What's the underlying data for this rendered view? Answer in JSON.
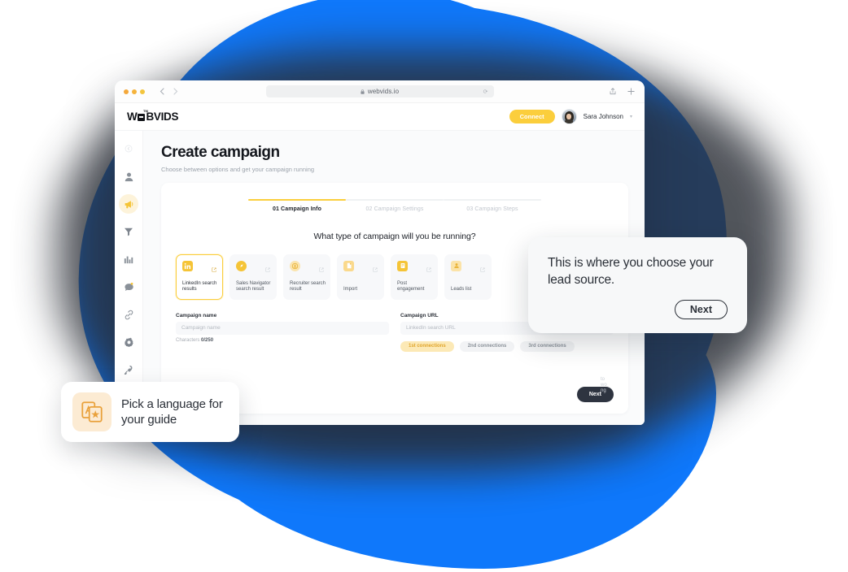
{
  "browser": {
    "url": "webvids.io",
    "lock_icon": "lock-icon",
    "reload_icon": "reload-icon",
    "back_icon": "chevron-left-icon",
    "forward_icon": "chevron-right-icon",
    "share_icon": "share-icon",
    "newtab_icon": "plus-icon",
    "traffic_lights": [
      "close-dot",
      "minimize-dot",
      "maximize-dot"
    ]
  },
  "app": {
    "logo": "WEBVIDS",
    "logo_mark": "E",
    "logo_trademark": "TM",
    "connect_label": "Connect",
    "user_name": "Sara Johnson",
    "user_chevron": "chevron-down-icon"
  },
  "sidebar": {
    "items": [
      {
        "icon": "collapse-icon",
        "name": "sidebar-item-collapse",
        "active": false
      },
      {
        "icon": "user-icon",
        "name": "sidebar-item-contacts",
        "active": false
      },
      {
        "icon": "megaphone-icon",
        "name": "sidebar-item-campaigns",
        "active": true
      },
      {
        "icon": "filter-icon",
        "name": "sidebar-item-filters",
        "active": false
      },
      {
        "icon": "bar-chart-icon",
        "name": "sidebar-item-analytics",
        "active": false
      },
      {
        "icon": "chat-icon",
        "name": "sidebar-item-inbox",
        "active": false
      },
      {
        "icon": "link-icon",
        "name": "sidebar-item-integrations",
        "active": false
      },
      {
        "icon": "gear-icon",
        "name": "sidebar-item-settings",
        "active": false
      },
      {
        "icon": "rocket-icon",
        "name": "sidebar-item-upgrade",
        "active": false
      }
    ]
  },
  "page": {
    "title": "Create campaign",
    "subtitle": "Choose between options and get your campaign running"
  },
  "wizard": {
    "steps": [
      {
        "num": "01",
        "label": "01 Campaign Info",
        "active": true
      },
      {
        "num": "02",
        "label": "02 Campaign Settings",
        "active": false
      },
      {
        "num": "03",
        "label": "03 Campaign Steps",
        "active": false
      }
    ],
    "question": "What type of campaign will you be running?",
    "campaign_types": [
      {
        "label": "LinkedIn search results",
        "icon": "linkedin-icon",
        "selected": true
      },
      {
        "label": "Sales Navigator search result",
        "icon": "compass-icon",
        "selected": false
      },
      {
        "label": "Recruiter search result",
        "icon": "recruiter-badge-icon",
        "selected": false
      },
      {
        "label": "Import",
        "icon": "file-import-icon",
        "selected": false
      },
      {
        "label": "Post engagement",
        "icon": "post-icon",
        "selected": false
      },
      {
        "label": "Leads list",
        "icon": "leads-list-icon",
        "selected": false
      }
    ],
    "external_icon": "external-link-icon",
    "campaign_name": {
      "label": "Campaign name",
      "placeholder": "Campaign name",
      "value": "",
      "char_prefix": "Characters",
      "char_count": "0/250"
    },
    "campaign_url": {
      "label": "Campaign URL",
      "placeholder": "LinkedIn search URL",
      "value": ""
    },
    "connections": [
      {
        "label": "1st connections",
        "selected": true
      },
      {
        "label": "2nd connections",
        "selected": false
      },
      {
        "label": "3rd connections",
        "selected": false
      }
    ],
    "next_label": "Next",
    "ghost_text": "to wo ng"
  },
  "callouts": {
    "lead_source": {
      "text": "This is where you choose your lead source.",
      "button": "Next"
    },
    "language": {
      "text": "Pick a language for your guide",
      "icon": "translate-icon"
    }
  },
  "colors": {
    "brand_blue": "#0F78FB",
    "accent_yellow": "#FBCE3C",
    "dark": "#2E3440"
  }
}
